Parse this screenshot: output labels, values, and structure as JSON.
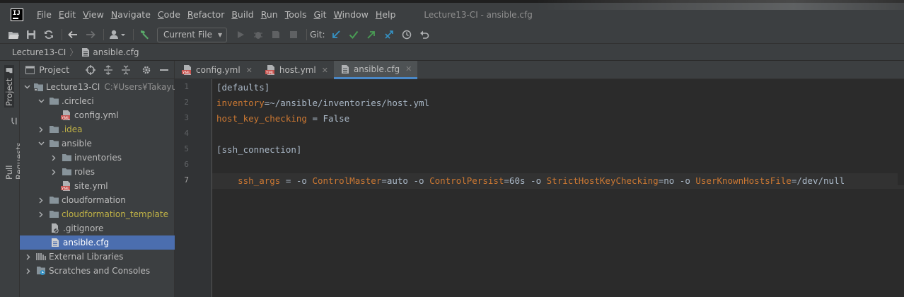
{
  "app": {
    "logo_text": "IJ",
    "window_title": "Lecture13-CI - ansible.cfg"
  },
  "menu": [
    {
      "label": "File",
      "mnemonic": "F",
      "rest": "ile"
    },
    {
      "label": "Edit",
      "mnemonic": "E",
      "rest": "dit"
    },
    {
      "label": "View",
      "mnemonic": "V",
      "rest": "iew"
    },
    {
      "label": "Navigate",
      "mnemonic": "N",
      "rest": "avigate"
    },
    {
      "label": "Code",
      "mnemonic": "C",
      "rest": "ode"
    },
    {
      "label": "Refactor",
      "mnemonic": "R",
      "rest": "efactor"
    },
    {
      "label": "Build",
      "mnemonic": "B",
      "rest": "uild"
    },
    {
      "label": "Run",
      "mnemonic": "R",
      "rest": "un"
    },
    {
      "label": "Tools",
      "mnemonic": "T",
      "rest": "ools"
    },
    {
      "label": "Git",
      "mnemonic": "G",
      "rest": "it"
    },
    {
      "label": "Window",
      "mnemonic": "W",
      "rest": "indow"
    },
    {
      "label": "Help",
      "mnemonic": "H",
      "rest": "elp"
    }
  ],
  "toolbar": {
    "run_config": "Current File",
    "git_label": "Git:"
  },
  "breadcrumb": {
    "project": "Lecture13-CI",
    "file": "ansible.cfg"
  },
  "stripe": {
    "project": "Project",
    "pull_requests": "Pull Requests"
  },
  "project_panel": {
    "title": "Project",
    "tree": [
      {
        "label": "Lecture13-CI",
        "path": "C:¥Users¥Takayuki¥I"
      },
      {
        "label": ".circleci"
      },
      {
        "label": "config.yml"
      },
      {
        "label": ".idea"
      },
      {
        "label": "ansible"
      },
      {
        "label": "inventories"
      },
      {
        "label": "roles"
      },
      {
        "label": "site.yml"
      },
      {
        "label": "cloudformation"
      },
      {
        "label": "cloudformation_template"
      },
      {
        "label": ".gitignore"
      },
      {
        "label": "ansible.cfg"
      },
      {
        "label": "External Libraries"
      },
      {
        "label": "Scratches and Consoles"
      }
    ]
  },
  "tabs": [
    {
      "label": "config.yml",
      "icon": "yaml-file-icon"
    },
    {
      "label": "host.yml",
      "icon": "yaml-file-icon"
    },
    {
      "label": "ansible.cfg",
      "icon": "text-file-icon"
    }
  ],
  "editor": {
    "line_numbers": [
      "1",
      "2",
      "3",
      "4",
      "5",
      "6",
      "7"
    ],
    "lines": [
      {
        "plain": "[defaults]"
      },
      {
        "key": "inventory",
        "rest": "=~/ansible/inventories/host.yml"
      },
      {
        "key": "host_key_checking",
        "rest": " = False"
      },
      {
        "plain": ""
      },
      {
        "plain": "[ssh_connection]"
      },
      {
        "segments": [
          {
            "t": "ssh_args",
            "k": true
          },
          {
            "t": " = -o ",
            "k": false
          },
          {
            "t": "ControlMaster",
            "k": true
          },
          {
            "t": "=auto -o ",
            "k": false
          },
          {
            "t": "ControlPersist",
            "k": true
          },
          {
            "t": "=60s -o ",
            "k": false
          },
          {
            "t": "StrictHostKeyChecking",
            "k": true
          },
          {
            "t": "=no -o ",
            "k": false
          },
          {
            "t": "UserKnownHostsFile",
            "k": true
          },
          {
            "t": "=/dev/null",
            "k": false
          }
        ]
      },
      {
        "plain": ""
      }
    ]
  },
  "colors": {
    "accent": "#4a88c7",
    "key_orange": "#cc7832",
    "text": "#a9b7c6",
    "selection": "#4b6eaf",
    "excluded_folder": "#c0b246"
  }
}
